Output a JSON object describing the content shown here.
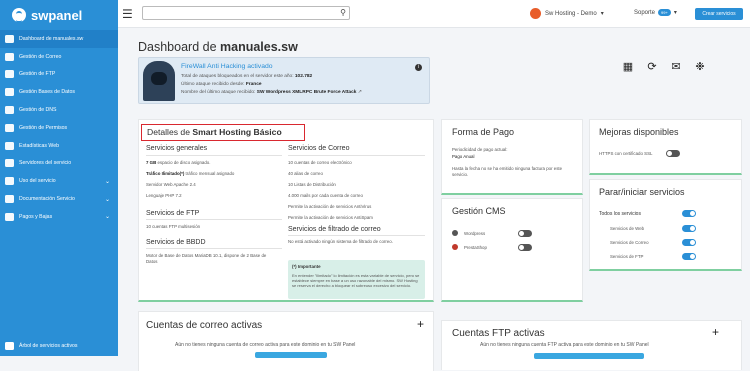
{
  "brand": {
    "name": "swpanel"
  },
  "sidebar": {
    "items": [
      {
        "label": "Dashboard de manuales.sw",
        "icon": "dashboard-icon"
      },
      {
        "label": "Gestión de Correo",
        "icon": "mail-icon"
      },
      {
        "label": "Gestión de FTP",
        "icon": "ftp-icon"
      },
      {
        "label": "Gestión Bases de Datos",
        "icon": "database-icon"
      },
      {
        "label": "Gestión de DNS",
        "icon": "dns-icon"
      },
      {
        "label": "Gestión de Permisos",
        "icon": "permissions-icon"
      },
      {
        "label": "Estadísticas Web",
        "icon": "stats-icon"
      },
      {
        "label": "Servidores del servicio",
        "icon": "server-icon"
      },
      {
        "label": "Uso del servicio",
        "icon": "usage-icon"
      },
      {
        "label": "Documentación Servicio",
        "icon": "docs-icon"
      },
      {
        "label": "Pagos y Bajas",
        "icon": "payments-icon"
      }
    ],
    "footer": "Árbol de servicios activos"
  },
  "topbar": {
    "account": "Sw Hosting - Demo",
    "support": "Soporte",
    "support_badge": "99+",
    "create_button": "Crear servicios"
  },
  "page": {
    "title_prefix": "Dashboard de ",
    "title_domain": "manuales.sw"
  },
  "firewall": {
    "title": "FireWall Anti Hacking activado",
    "line1_label": "Total de ataques bloqueados en el servidor este año:",
    "line1_value": "102.782",
    "line2_label": "Último ataque recibido desde:",
    "line2_value": "France",
    "line3_label": "Nombre del último ataque recibido:",
    "line3_value": "SW Wordpress XMLRPC Brute Force Attack"
  },
  "detail": {
    "title_prefix": "Detalles de ",
    "title_plan": "Smart Hosting Básico",
    "general_title": "Servicios generales",
    "general": [
      {
        "b": "7 GB",
        "t": " espacio de disco asignado."
      },
      {
        "b": "Tráfico Ilimitado(*)",
        "t": " tráfico mensual asignado"
      },
      {
        "b": "",
        "t": "Servidor Web Apache 2.4"
      },
      {
        "b": "",
        "t": "Lenguaje PHP 7.2"
      }
    ],
    "ftp_title": "Servicios de FTP",
    "ftp": "10 cuentas FTP multisesión",
    "db_title": "Servicios de BBDD",
    "db": "Motor de Base de Datos MariaDB 10.1, dispone de 2 Base de Datos",
    "mail_title": "Servicios de Correo",
    "mail": [
      "10 cuentas de correo electrónico",
      "40 alias de correo",
      "10 Listas de Distribución",
      "4.000 mails por cada cuenta de correo",
      "Permite la activación de servicios AntiVirus",
      "Permite la activación de servicios AntiSpam"
    ],
    "filter_title": "Servicios de filtrado de correo",
    "filter": "No está activado ningún sistema de filtrado de correo.",
    "notice_title": "(*) Importante",
    "notice_body": "En entender \"ilimitado\" lo limitación es esta variable de servicio, pero se establece siempre en base a un uso razonable del mismo. SW Hosting se reserva el derecho a bloquear el sobreuso excesivo del servicio."
  },
  "pago": {
    "title": "Forma de Pago",
    "line1": "Periodicidad de pago actual:",
    "line2": "Pago Anual",
    "line3": "Hasta la fecha no se ha emitido ninguna factura por este servicio."
  },
  "cms": {
    "title": "Gestión CMS",
    "items": [
      "Wordpress",
      "PrestaShop"
    ]
  },
  "mejoras": {
    "title": "Mejoras disponibles",
    "item": "HTTPS con certificado SSL"
  },
  "parar": {
    "title": "Parar/iniciar servicios",
    "all": "Todos los servicios",
    "items": [
      "Servicios de Web",
      "Servicios de Correo",
      "Servicios de FTP"
    ]
  },
  "correo": {
    "title": "Cuentas de correo activas",
    "empty": "Aún no tienes ninguna cuenta de correo activa para este dominio en tu SW Panel"
  },
  "ftpcard": {
    "title": "Cuentas FTP activas",
    "empty": "Aún no tienes ninguna cuenta FTP activa para este dominio en tu SW Panel"
  },
  "colors": {
    "accent": "#2a8fd6",
    "highlight": "#d9282f",
    "card_border": "#7fcfa0"
  }
}
